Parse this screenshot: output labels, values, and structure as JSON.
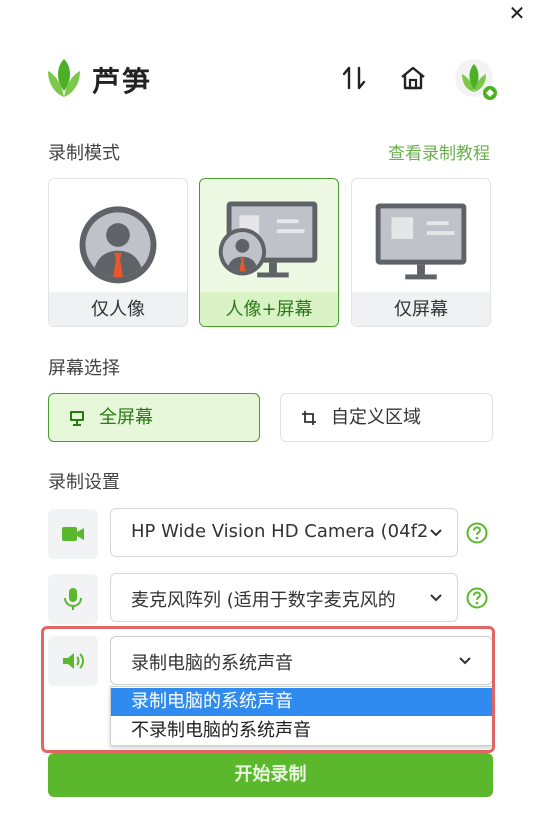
{
  "window": {
    "close_icon": "close-icon"
  },
  "header": {
    "app_title": "芦笋",
    "icons": [
      "swap-icon",
      "home-icon",
      "user-avatar"
    ]
  },
  "record_mode": {
    "label": "录制模式",
    "tutorial_link": "查看录制教程",
    "modes": [
      {
        "label": "仅人像",
        "icon": "person-portrait-icon",
        "selected": false
      },
      {
        "label": "人像+屏幕",
        "icon": "person-screen-icon",
        "selected": true
      },
      {
        "label": "仅屏幕",
        "icon": "screen-icon",
        "selected": false
      }
    ]
  },
  "screen_select": {
    "label": "屏幕选择",
    "options": [
      {
        "label": "全屏幕",
        "icon": "monitor-icon",
        "selected": true
      },
      {
        "label": "自定义区域",
        "icon": "crop-icon",
        "selected": false
      }
    ]
  },
  "record_settings": {
    "label": "录制设置",
    "camera": {
      "icon": "camera-icon",
      "value": "HP Wide Vision HD Camera (04f2"
    },
    "microphone": {
      "icon": "microphone-icon",
      "value": "麦克风阵列 (适用于数字麦克风的"
    },
    "system_audio": {
      "icon": "speaker-icon",
      "value": "录制电脑的系统声音",
      "options": [
        "录制电脑的系统声音",
        "不录制电脑的系统声音"
      ],
      "selected_index": 0
    }
  },
  "start_button": "开始录制",
  "colors": {
    "accent_green": "#5bb82c",
    "link_green": "#6ab04c",
    "highlight_red": "#e06666",
    "dropdown_selected_blue": "#2f8bf0"
  }
}
